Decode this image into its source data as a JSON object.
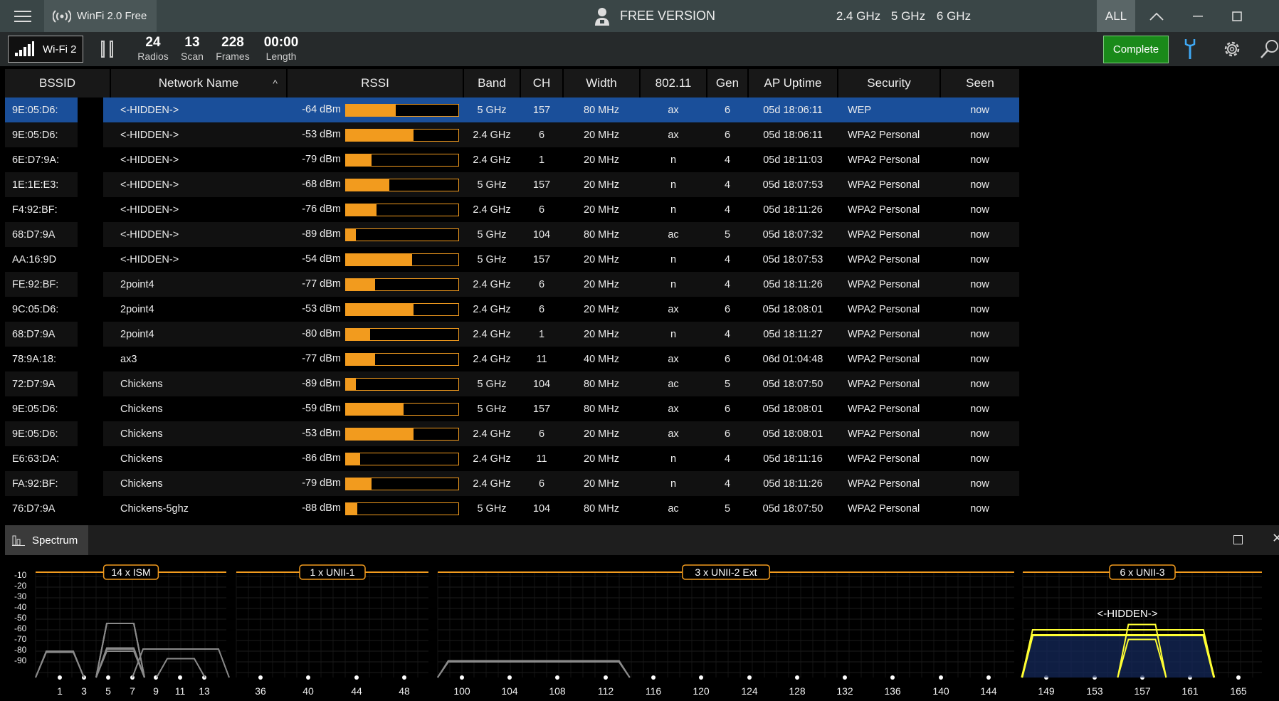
{
  "app": {
    "title": "WinFi 2.0 Free",
    "license": "FREE VERSION"
  },
  "bands": [
    "2.4 GHz",
    "5 GHz",
    "6 GHz",
    "ALL"
  ],
  "active_band": "ALL",
  "toolbar": {
    "radio": "Wi-Fi 2",
    "stats": [
      {
        "value": "24",
        "label": "Radios"
      },
      {
        "value": "13",
        "label": "Scan"
      },
      {
        "value": "228",
        "label": "Frames"
      },
      {
        "value": "00:00",
        "label": "Length"
      }
    ],
    "complete_label": "Complete"
  },
  "table": {
    "columns": [
      "BSSID",
      "Network Name",
      "RSSI",
      "Band",
      "CH",
      "Width",
      "802.11",
      "Gen",
      "AP Uptime",
      "Security",
      "Seen"
    ],
    "sort_indicator": "^",
    "rows": [
      {
        "bssid": "9E:05:D6:",
        "name": "<-HIDDEN->",
        "rssi": "-64 dBm",
        "dbm": -64,
        "band": "5 GHz",
        "ch": "157",
        "width": "80 MHz",
        "std": "ax",
        "gen": "6",
        "uptime": "05d 18:06:11",
        "security": "WEP",
        "seen": "now"
      },
      {
        "bssid": "9E:05:D6:",
        "name": "<-HIDDEN->",
        "rssi": "-53 dBm",
        "dbm": -53,
        "band": "2.4 GHz",
        "ch": "6",
        "width": "20 MHz",
        "std": "ax",
        "gen": "6",
        "uptime": "05d 18:06:11",
        "security": "WPA2 Personal",
        "seen": "now"
      },
      {
        "bssid": "6E:D7:9A:",
        "name": "<-HIDDEN->",
        "rssi": "-79 dBm",
        "dbm": -79,
        "band": "2.4 GHz",
        "ch": "1",
        "width": "20 MHz",
        "std": "n",
        "gen": "4",
        "uptime": "05d 18:11:03",
        "security": "WPA2 Personal",
        "seen": "now"
      },
      {
        "bssid": "1E:1E:E3:",
        "name": "<-HIDDEN->",
        "rssi": "-68 dBm",
        "dbm": -68,
        "band": "5 GHz",
        "ch": "157",
        "width": "20 MHz",
        "std": "n",
        "gen": "4",
        "uptime": "05d 18:07:53",
        "security": "WPA2 Personal",
        "seen": "now"
      },
      {
        "bssid": "F4:92:BF:",
        "name": "<-HIDDEN->",
        "rssi": "-76 dBm",
        "dbm": -76,
        "band": "2.4 GHz",
        "ch": "6",
        "width": "20 MHz",
        "std": "n",
        "gen": "4",
        "uptime": "05d 18:11:26",
        "security": "WPA2 Personal",
        "seen": "now"
      },
      {
        "bssid": "68:D7:9A",
        "name": "<-HIDDEN->",
        "rssi": "-89 dBm",
        "dbm": -89,
        "band": "5 GHz",
        "ch": "104",
        "width": "80 MHz",
        "std": "ac",
        "gen": "5",
        "uptime": "05d 18:07:32",
        "security": "WPA2 Personal",
        "seen": "now"
      },
      {
        "bssid": "AA:16:9D",
        "name": "<-HIDDEN->",
        "rssi": "-54 dBm",
        "dbm": -54,
        "band": "5 GHz",
        "ch": "157",
        "width": "20 MHz",
        "std": "n",
        "gen": "4",
        "uptime": "05d 18:07:53",
        "security": "WPA2 Personal",
        "seen": "now"
      },
      {
        "bssid": "FE:92:BF:",
        "name": "2point4",
        "rssi": "-77 dBm",
        "dbm": -77,
        "band": "2.4 GHz",
        "ch": "6",
        "width": "20 MHz",
        "std": "n",
        "gen": "4",
        "uptime": "05d 18:11:26",
        "security": "WPA2 Personal",
        "seen": "now"
      },
      {
        "bssid": "9C:05:D6:",
        "name": "2point4",
        "rssi": "-53 dBm",
        "dbm": -53,
        "band": "2.4 GHz",
        "ch": "6",
        "width": "20 MHz",
        "std": "ax",
        "gen": "6",
        "uptime": "05d 18:08:01",
        "security": "WPA2 Personal",
        "seen": "now"
      },
      {
        "bssid": "68:D7:9A",
        "name": "2point4",
        "rssi": "-80 dBm",
        "dbm": -80,
        "band": "2.4 GHz",
        "ch": "1",
        "width": "20 MHz",
        "std": "n",
        "gen": "4",
        "uptime": "05d 18:11:27",
        "security": "WPA2 Personal",
        "seen": "now"
      },
      {
        "bssid": "78:9A:18:",
        "name": "ax3",
        "rssi": "-77 dBm",
        "dbm": -77,
        "band": "2.4 GHz",
        "ch": "11",
        "width": "40 MHz",
        "std": "ax",
        "gen": "6",
        "uptime": "06d 01:04:48",
        "security": "WPA2 Personal",
        "seen": "now"
      },
      {
        "bssid": "72:D7:9A",
        "name": "Chickens",
        "rssi": "-89 dBm",
        "dbm": -89,
        "band": "5 GHz",
        "ch": "104",
        "width": "80 MHz",
        "std": "ac",
        "gen": "5",
        "uptime": "05d 18:07:50",
        "security": "WPA2 Personal",
        "seen": "now"
      },
      {
        "bssid": "9E:05:D6:",
        "name": "Chickens",
        "rssi": "-59 dBm",
        "dbm": -59,
        "band": "5 GHz",
        "ch": "157",
        "width": "80 MHz",
        "std": "ax",
        "gen": "6",
        "uptime": "05d 18:08:01",
        "security": "WPA2 Personal",
        "seen": "now"
      },
      {
        "bssid": "9E:05:D6:",
        "name": "Chickens",
        "rssi": "-53 dBm",
        "dbm": -53,
        "band": "2.4 GHz",
        "ch": "6",
        "width": "20 MHz",
        "std": "ax",
        "gen": "6",
        "uptime": "05d 18:08:01",
        "security": "WPA2 Personal",
        "seen": "now"
      },
      {
        "bssid": "E6:63:DA:",
        "name": "Chickens",
        "rssi": "-86 dBm",
        "dbm": -86,
        "band": "2.4 GHz",
        "ch": "11",
        "width": "20 MHz",
        "std": "n",
        "gen": "4",
        "uptime": "05d 18:11:16",
        "security": "WPA2 Personal",
        "seen": "now"
      },
      {
        "bssid": "FA:92:BF:",
        "name": "Chickens",
        "rssi": "-79 dBm",
        "dbm": -79,
        "band": "2.4 GHz",
        "ch": "6",
        "width": "20 MHz",
        "std": "n",
        "gen": "4",
        "uptime": "05d 18:11:26",
        "security": "WPA2 Personal",
        "seen": "now"
      },
      {
        "bssid": "76:D7:9A",
        "name": "Chickens-5ghz",
        "rssi": "-88 dBm",
        "dbm": -88,
        "band": "5 GHz",
        "ch": "104",
        "width": "80 MHz",
        "std": "ac",
        "gen": "5",
        "uptime": "05d 18:07:50",
        "security": "WPA2 Personal",
        "seen": "now"
      }
    ]
  },
  "spectrum": {
    "tab_label": "Spectrum",
    "y_ticks": [
      "-10",
      "-20",
      "-30",
      "-40",
      "-50",
      "-60",
      "-70",
      "-80",
      "-90"
    ],
    "groups": [
      {
        "label": "14 x ISM",
        "ticks": [
          "1",
          "3",
          "5",
          "7",
          "9",
          "11",
          "13"
        ]
      },
      {
        "label": "1 x UNII-1",
        "ticks": [
          "36",
          "40",
          "44",
          "48"
        ]
      },
      {
        "label": "3 x UNII-2 Ext",
        "ticks": [
          "100",
          "104",
          "108",
          "112",
          "116",
          "120",
          "124",
          "128",
          "132",
          "136",
          "140",
          "144"
        ]
      },
      {
        "label": "6 x UNII-3",
        "ticks": [
          "149",
          "153",
          "157",
          "161",
          "165"
        ]
      }
    ],
    "highlight_label": "<-HIDDEN->",
    "colors": {
      "accent": "#f29b1e",
      "selection": "#1a4f9a",
      "highlight": "#ffff33",
      "trace": "#8a8a8a"
    }
  }
}
